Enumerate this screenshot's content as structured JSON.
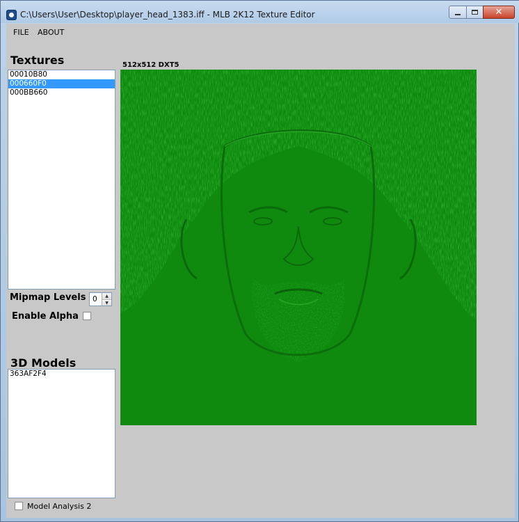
{
  "window": {
    "title": "C:\\Users\\User\\Desktop\\player_head_1383.iff - MLB 2K12 Texture Editor",
    "close_glyph": "✕"
  },
  "menu": {
    "file": "FILE",
    "about": "ABOUT"
  },
  "textures": {
    "heading": "Textures",
    "items": [
      "00010B80",
      "000660F0",
      "000BB660"
    ],
    "selected_index": 1
  },
  "mipmap": {
    "label": "Mipmap Levels",
    "value": "0"
  },
  "enable_alpha": {
    "label": "Enable Alpha",
    "checked": false
  },
  "models": {
    "heading": "3D Models",
    "items": [
      "363AF2F4"
    ]
  },
  "model_analysis": {
    "label": "Model Analysis 2",
    "checked": false
  },
  "preview": {
    "caption": "512x512 DXT5",
    "base_color": "#0f8a0f"
  }
}
